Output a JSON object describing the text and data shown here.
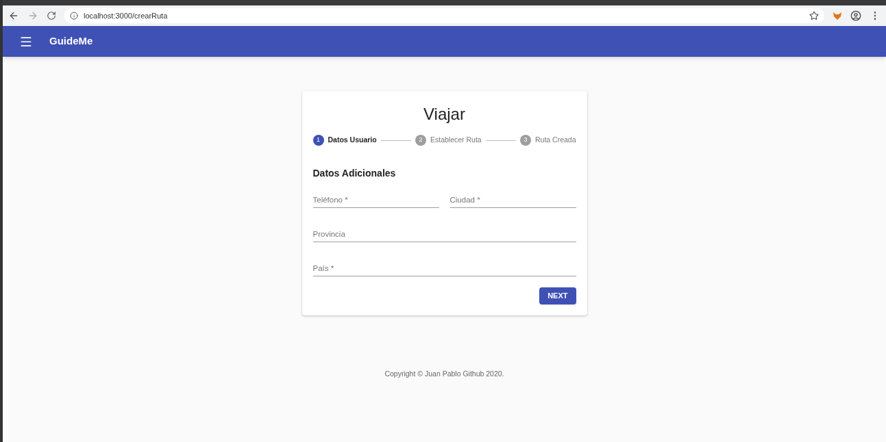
{
  "browser": {
    "url": "localhost:3000/crearRuta"
  },
  "app_bar": {
    "title": "GuideMe"
  },
  "card": {
    "title": "Viajar",
    "steps": [
      {
        "number": "1",
        "label": "Datos Usuario",
        "selected": true
      },
      {
        "number": "2",
        "label": "Establecer Ruta",
        "selected": false
      },
      {
        "number": "3",
        "label": "Ruta Creada",
        "selected": false
      }
    ],
    "section_title": "Datos Adicionales",
    "field_rows": [
      [
        {
          "placeholder": "Teléfono *"
        },
        {
          "placeholder": "Ciudad *"
        }
      ],
      [
        {
          "placeholder": "Provincia"
        }
      ],
      [
        {
          "placeholder": "País *"
        }
      ]
    ],
    "button": "NEXT"
  },
  "footer": "Copyright © Juan Pablo Github 2020."
}
